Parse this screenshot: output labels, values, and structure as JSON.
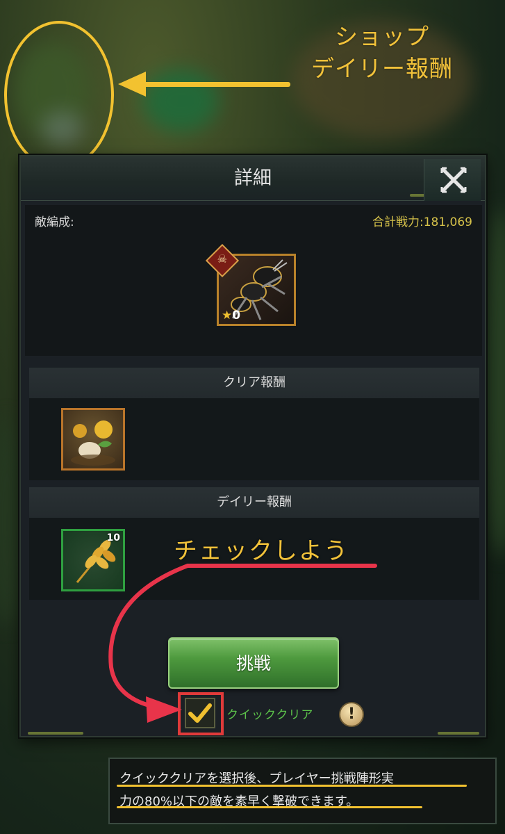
{
  "annotation_top": {
    "lines": [
      "ショップ",
      "デイリー報酬"
    ],
    "color": "#f2c230"
  },
  "dialog": {
    "title": "詳細",
    "close_icon": "close-x-icon",
    "enemy_label": "敵編成:",
    "total_power": "合計戦力:181,069",
    "enemy_unit": {
      "icon": "ant-icon",
      "badge_icon": "skull-icon",
      "star_icon": "star-icon",
      "star_count": "0"
    },
    "clear_reward_header": "クリア報酬",
    "clear_reward_item": {
      "icon": "flower-seed-icon"
    },
    "daily_reward_header": "デイリー報酬",
    "daily_reward_item": {
      "icon": "wheat-icon",
      "count": "10"
    },
    "challenge_button": "挑戦",
    "quick_clear_label": "クイッククリア",
    "quick_clear_checked": true,
    "info_icon": "!"
  },
  "annotation_check": {
    "text": "チェックしよう",
    "arrow_color": "#e8344a"
  },
  "tooltip": {
    "line1": "クイッククリアを選択後、プレイヤー挑戦陣形実",
    "line2": "力の80%以下の敵を素早く撃破できます。"
  }
}
